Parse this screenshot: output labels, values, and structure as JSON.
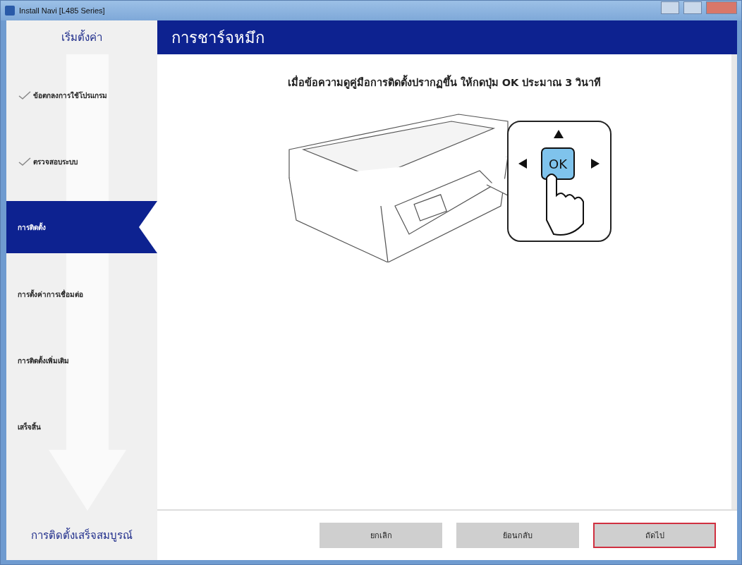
{
  "window": {
    "title": "Install Navi [L485 Series]"
  },
  "sidebar": {
    "header": "เริ่มตั้งค่า",
    "steps": [
      {
        "label": "ข้อตกลงการใช้โปรแกรม",
        "done": true,
        "selected": false
      },
      {
        "label": "ตรวจสอบระบบ",
        "done": true,
        "selected": false
      },
      {
        "label": "การติดตั้ง",
        "done": false,
        "selected": true
      },
      {
        "label": "การตั้งค่าการเชื่อมต่อ",
        "done": false,
        "selected": false
      },
      {
        "label": "การติดตั้งเพิ่มเติม",
        "done": false,
        "selected": false
      },
      {
        "label": "เสร็จสิ้น",
        "done": false,
        "selected": false
      }
    ],
    "footer": "การติดตั้งเสร็จสมบูรณ์"
  },
  "page": {
    "title": "การชาร์จหมึก",
    "instruction": "เมื่อข้อความดูคู่มือการติดตั้งปรากฏขึ้น ให้กดปุ่ม OK ประมาณ 3 วินาที",
    "illustration": {
      "key_label": "OK"
    }
  },
  "buttons": [
    {
      "label": "ยกเลิก",
      "focused": false
    },
    {
      "label": "ย้อนกลับ",
      "focused": false
    },
    {
      "label": "ถัดไป",
      "focused": true
    }
  ]
}
